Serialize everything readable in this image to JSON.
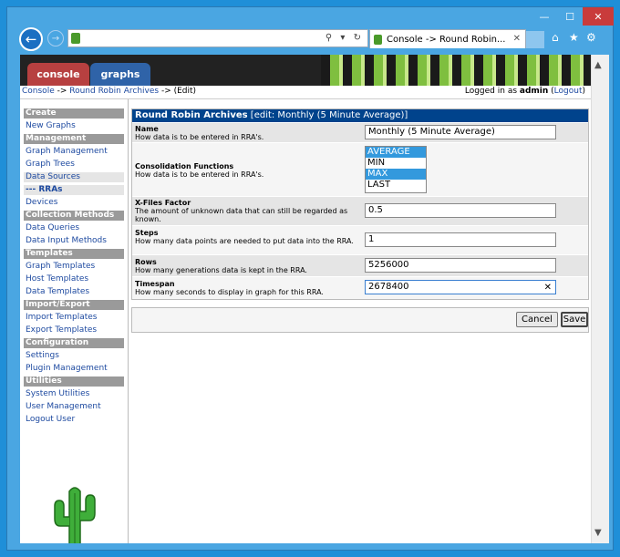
{
  "browser": {
    "window_controls": {
      "minimize": "—",
      "maximize": "☐",
      "close": "✕"
    },
    "back_glyph": "←",
    "forward_glyph": "→",
    "address_tools": "⚲ ▾ ↻",
    "tab": {
      "title": "Console -> Round Robin...",
      "close_glyph": "✕"
    },
    "right_icons": {
      "home": "⌂",
      "favorites": "★",
      "settings": "⚙"
    }
  },
  "banner": {
    "tabs": [
      {
        "label": "console"
      },
      {
        "label": "graphs"
      }
    ]
  },
  "breadcrumb": {
    "console": "Console",
    "sep1": " -> ",
    "rra": "Round Robin Archives",
    "sep2": " -> ",
    "current": "(Edit)",
    "logged_prefix": "Logged in as ",
    "user": "admin",
    "logout_open": " (",
    "logout": "Logout",
    "logout_close": ")"
  },
  "sidebar": {
    "sections": [
      {
        "header": "Create",
        "items": [
          "New Graphs"
        ]
      },
      {
        "header": "Management",
        "items": [
          "Graph Management",
          "Graph Trees",
          "Data Sources",
          "--- RRAs",
          "Devices"
        ]
      },
      {
        "header": "Collection Methods",
        "items": [
          "Data Queries",
          "Data Input Methods"
        ]
      },
      {
        "header": "Templates",
        "items": [
          "Graph Templates",
          "Host Templates",
          "Data Templates"
        ]
      },
      {
        "header": "Import/Export",
        "items": [
          "Import Templates",
          "Export Templates"
        ]
      },
      {
        "header": "Configuration",
        "items": [
          "Settings",
          "Plugin Management"
        ]
      },
      {
        "header": "Utilities",
        "items": [
          "System Utilities",
          "User Management",
          "Logout User"
        ]
      }
    ]
  },
  "form": {
    "title_bold": "Round Robin Archives",
    "title_rest": " [edit: Monthly (5 Minute Average)]",
    "fields": {
      "name": {
        "label": "Name",
        "desc": "How data is to be entered in RRA's.",
        "value": "Monthly (5 Minute Average)"
      },
      "cf": {
        "label": "Consolidation Functions",
        "desc": "How data is to be entered in RRA's.",
        "options": [
          "AVERAGE",
          "MIN",
          "MAX",
          "LAST"
        ],
        "selected": [
          "AVERAGE",
          "MAX"
        ]
      },
      "xff": {
        "label": "X-Files Factor",
        "desc": "The amount of unknown data that can still be regarded as known.",
        "value": "0.5"
      },
      "steps": {
        "label": "Steps",
        "desc": "How many data points are needed to put data into the RRA.",
        "value": "1"
      },
      "rows": {
        "label": "Rows",
        "desc": "How many generations data is kept in the RRA.",
        "value": "5256000"
      },
      "timespan": {
        "label": "Timespan",
        "desc": "How many seconds to display in graph for this RRA.",
        "value": "2678400",
        "clear_glyph": "✕"
      }
    },
    "buttons": {
      "cancel": "Cancel",
      "save": "Save"
    }
  },
  "scrollbar": {
    "up_glyph": "▲",
    "down_glyph": "▼"
  },
  "colors": {
    "header_blue": "#00438c",
    "link_blue": "#1e4aa0",
    "cactus_green": "#3fae3a"
  }
}
